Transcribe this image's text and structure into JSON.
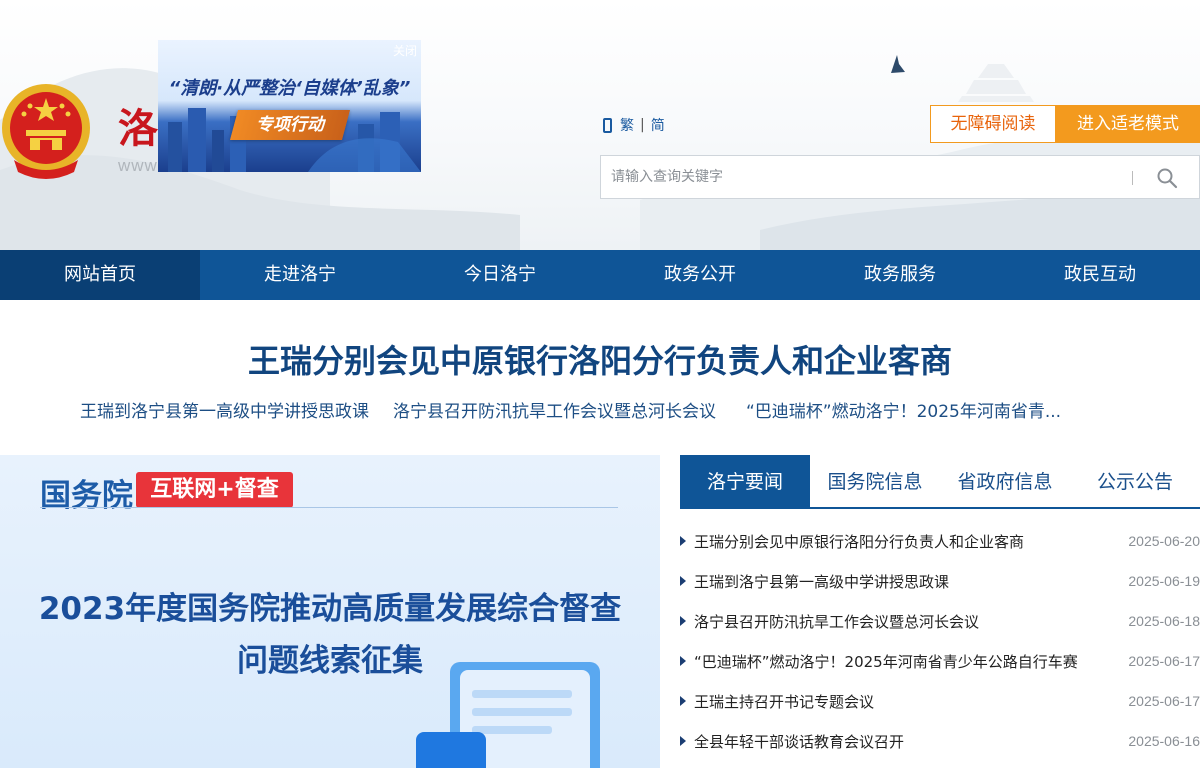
{
  "header": {
    "site_name": "洛",
    "site_url": "www",
    "colors": {
      "brand_red": "#c8161d",
      "accent_orange": "#f39a1e",
      "nav_blue": "#0f5597"
    }
  },
  "ad": {
    "close_label": "关闭",
    "slogan": "“清朗·从严整治‘自媒体’乱象”",
    "tag": "专项行动"
  },
  "lang": {
    "traditional": "繁",
    "separator": "|",
    "simplified": "简"
  },
  "buttons": {
    "accessible_reading": "无障碍阅读",
    "elder_mode": "进入适老模式"
  },
  "search": {
    "placeholder": "请输入查询关键字"
  },
  "nav": {
    "items": [
      {
        "label": "网站首页"
      },
      {
        "label": "走进洛宁"
      },
      {
        "label": "今日洛宁"
      },
      {
        "label": "政务公开"
      },
      {
        "label": "政务服务"
      },
      {
        "label": "政民互动"
      }
    ]
  },
  "headline": {
    "main": "王瑞分别会见中原银行洛阳分行负责人和企业客商",
    "subs": [
      "王瑞到洛宁县第一高级中学讲授思政课",
      "洛宁县召开防汛抗旱工作会议暨总河长会议",
      "“巴迪瑞杯”燃动洛宁！2025年河南省青..."
    ]
  },
  "banner": {
    "org": "国务院",
    "badge": "互联网+督查",
    "title_line1": "2023年度国务院推动高质量发展综合督查",
    "title_line2": "问题线索征集"
  },
  "tabs": [
    {
      "label": "洛宁要闻"
    },
    {
      "label": "国务院信息"
    },
    {
      "label": "省政府信息"
    },
    {
      "label": "公示公告"
    }
  ],
  "news": [
    {
      "title": "王瑞分别会见中原银行洛阳分行负责人和企业客商",
      "date": "2025-06-20"
    },
    {
      "title": "王瑞到洛宁县第一高级中学讲授思政课",
      "date": "2025-06-19"
    },
    {
      "title": "洛宁县召开防汛抗旱工作会议暨总河长会议",
      "date": "2025-06-18"
    },
    {
      "title": "“巴迪瑞杯”燃动洛宁！2025年河南省青少年公路自行车赛",
      "date": "2025-06-17"
    },
    {
      "title": "王瑞主持召开书记专题会议",
      "date": "2025-06-17"
    },
    {
      "title": "全县年轻干部谈话教育会议召开",
      "date": "2025-06-16"
    }
  ]
}
